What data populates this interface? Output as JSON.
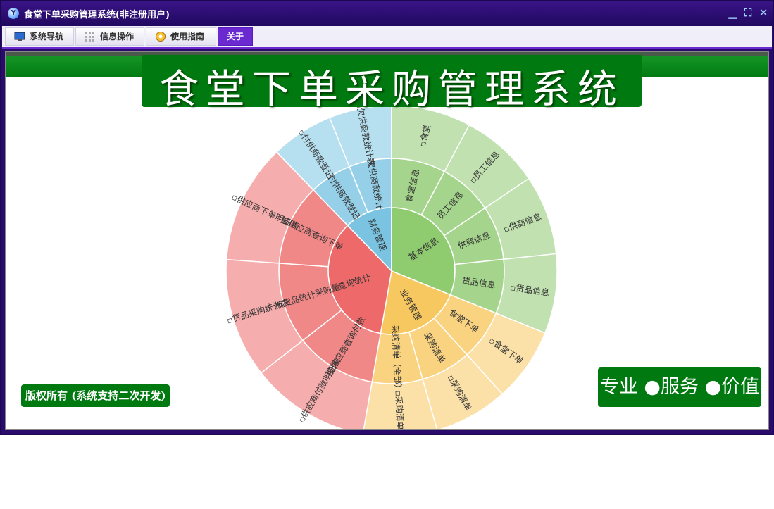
{
  "window": {
    "title": "食堂下单采购管理系统(非注册用户)",
    "logo_text": "Y",
    "controls": {
      "minimize": "▁",
      "restore": "⛶",
      "close": "✕"
    }
  },
  "menu": [
    {
      "label": "系统导航",
      "icon": "monitor-icon"
    },
    {
      "label": "信息操作",
      "icon": "grid-icon"
    },
    {
      "label": "使用指南",
      "icon": "guide-icon"
    },
    {
      "label": "关于",
      "icon": ""
    }
  ],
  "main": {
    "title": "食堂下单采购管理系统",
    "copyright": "版权所有 (系统支持二次开发)",
    "slogan": "专业 ●服务 ●价值"
  },
  "colors": {
    "titlebar": "#2a0a6a",
    "accent": "#6a2ad0",
    "green": "#007a10",
    "finance": "#7ac4e2",
    "basic": "#8fcb6f",
    "business": "#f8c860",
    "query": "#ee6a6a"
  },
  "sunburst": [
    {
      "label": "财务管理",
      "color": "#7ac4e2",
      "children": [
        {
          "label": "付供商款登记",
          "children": [
            {
              "label": "▫付供商款登记"
            }
          ]
        },
        {
          "label": "欠供商款统计",
          "children": [
            {
              "label": "▫欠供商款统计表"
            }
          ]
        }
      ]
    },
    {
      "label": "基本信息",
      "color": "#8fcb6f",
      "children": [
        {
          "label": "食堂信息",
          "children": [
            {
              "label": "▫食堂"
            }
          ]
        },
        {
          "label": "员工信息",
          "children": [
            {
              "label": "▫员工信息"
            }
          ]
        },
        {
          "label": "供商信息",
          "children": [
            {
              "label": "▫供商信息"
            }
          ]
        },
        {
          "label": "货品信息",
          "children": [
            {
              "label": "▫货品信息"
            }
          ]
        }
      ]
    },
    {
      "label": "业务管理",
      "color": "#f8c860",
      "children": [
        {
          "label": "食堂下单",
          "children": [
            {
              "label": "▫食堂下单"
            }
          ]
        },
        {
          "label": "采购清单",
          "children": [
            {
              "label": "▫采购清单"
            }
          ]
        },
        {
          "label": "采购清单（全部）",
          "children": [
            {
              "label": "▫采购清单"
            }
          ]
        }
      ]
    },
    {
      "label": "查询统计",
      "color": "#ee6a6a",
      "children": [
        {
          "label": "按供应商查询付款",
          "children": [
            {
              "label": "▫供应商付款明细表"
            }
          ]
        },
        {
          "label": "按货品统计采购量",
          "children": [
            {
              "label": "▫货品采购统计表"
            }
          ]
        },
        {
          "label": "按供应商查询下单",
          "children": [
            {
              "label": "▫供应商下单明细表"
            }
          ]
        }
      ]
    }
  ]
}
